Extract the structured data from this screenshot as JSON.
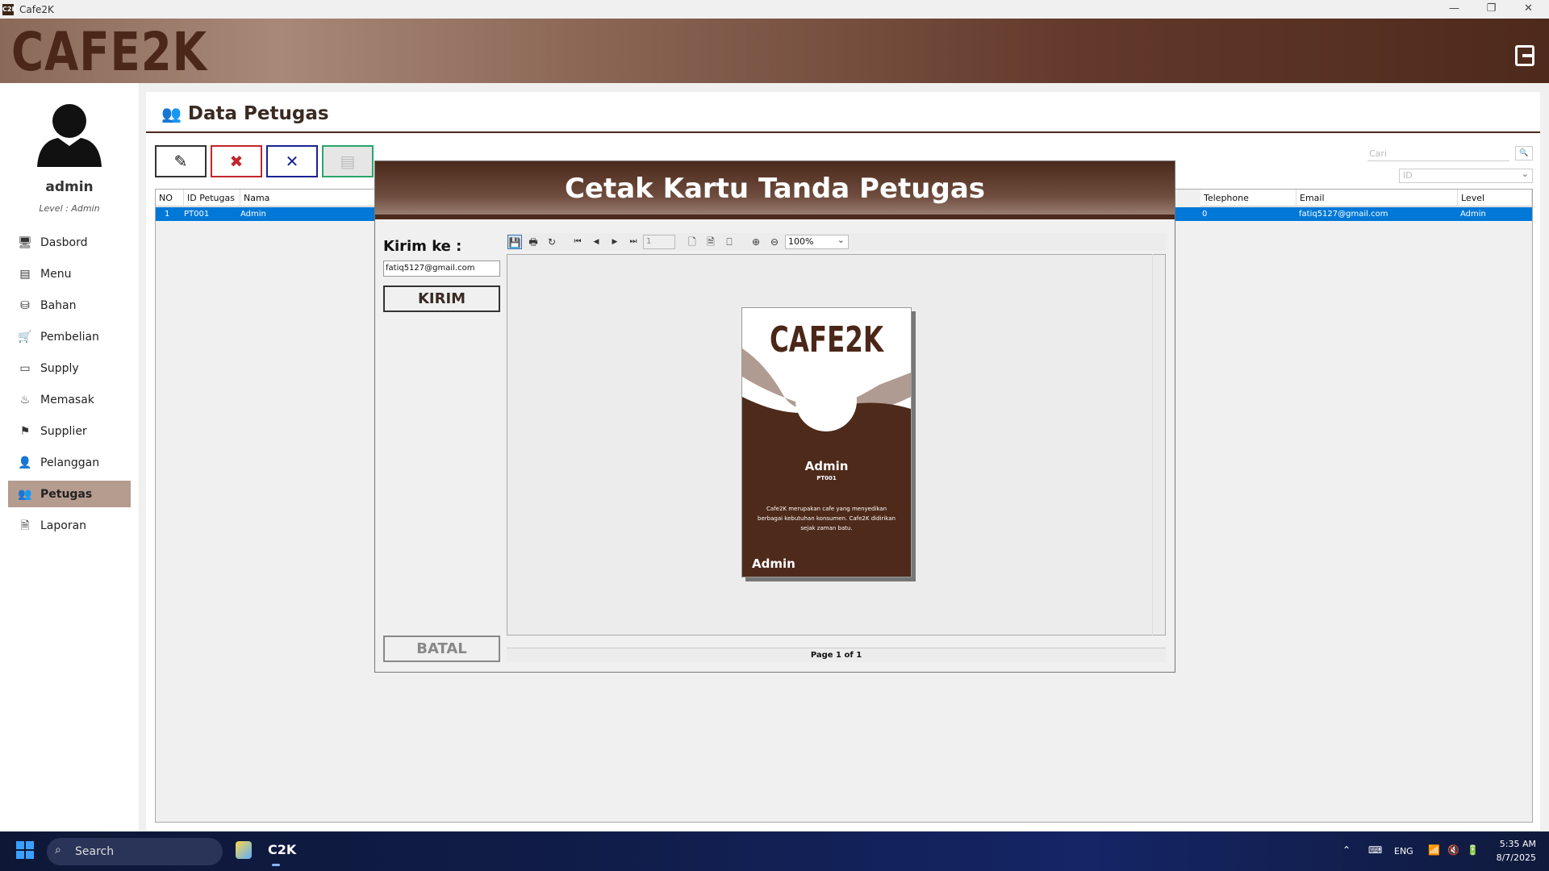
{
  "window": {
    "title": "Cafe2K",
    "app_icon": "C2K",
    "minimize": "—",
    "restore": "❐",
    "close": "✕"
  },
  "header": {
    "logo": "CAFE2K"
  },
  "user": {
    "name": "admin",
    "level": "Level : Admin"
  },
  "sidebar": {
    "items": [
      {
        "label": "Dasbord",
        "icon": "monitor-icon",
        "glyph": "🖥"
      },
      {
        "label": "Menu",
        "icon": "menu-book-icon",
        "glyph": "▤"
      },
      {
        "label": "Bahan",
        "icon": "ingredients-icon",
        "glyph": "⛁"
      },
      {
        "label": "Pembelian",
        "icon": "cart-icon",
        "glyph": "🛒"
      },
      {
        "label": "Supply",
        "icon": "box-icon",
        "glyph": "▭"
      },
      {
        "label": "Memasak",
        "icon": "pot-icon",
        "glyph": "♨"
      },
      {
        "label": "Supplier",
        "icon": "supplier-icon",
        "glyph": "⚑"
      },
      {
        "label": "Pelanggan",
        "icon": "customer-icon",
        "glyph": "👤"
      },
      {
        "label": "Petugas",
        "icon": "staff-icon",
        "glyph": "👥"
      },
      {
        "label": "Laporan",
        "icon": "report-icon",
        "glyph": "🗎"
      }
    ],
    "active": "Petugas"
  },
  "page": {
    "title": "Data Petugas",
    "title_icon": "users-icon"
  },
  "toolbar": {
    "edit": "✎",
    "delete": "✖",
    "cancel": "✕",
    "card": "▤"
  },
  "search": {
    "placeholder": "Cari",
    "button": "🔍",
    "filter_value": "ID"
  },
  "table": {
    "columns": [
      "NO",
      "ID Petugas",
      "Nama",
      "Telephone",
      "Email",
      "Level"
    ],
    "rows": [
      {
        "no": "1",
        "id": "PT001",
        "nama": "Admin",
        "telephone": "0",
        "email": "fatiq5127@gmail.com",
        "level": "Admin"
      }
    ]
  },
  "dialog": {
    "title": "Cetak Kartu Tanda Petugas",
    "send_to_label": "Kirim ke :",
    "email_value": "fatiq5127@gmail.com",
    "send_button": "KIRIM",
    "cancel_button": "BATAL",
    "report": {
      "page_input": "1",
      "zoom": "100%",
      "footer": "Page 1 of 1"
    },
    "card": {
      "logo": "CAFE2K",
      "name": "Admin",
      "id": "PT001",
      "description": "Cafe2K merupakan cafe yang menyedikan berbagai kebutuhan konsumen. Cafe2K didirikan sejak zaman batu.",
      "footer_name": "Admin"
    }
  },
  "taskbar": {
    "search": "Search",
    "lang": "ENG",
    "time": "5:35 AM",
    "date": "8/7/2025",
    "app": "C2K"
  },
  "colors": {
    "brand_dark": "#4a2718",
    "selection": "#0078d7",
    "active_nav": "#b69b8f"
  }
}
